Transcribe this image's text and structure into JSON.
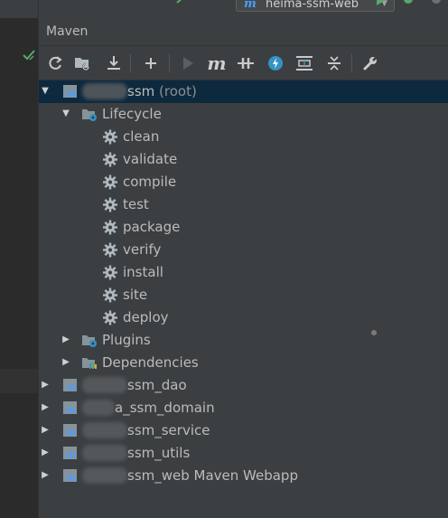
{
  "run_toolbar": {
    "configuration": "heima-ssm-web"
  },
  "panel": {
    "title": "Maven"
  },
  "toolbar_icons": [
    "reimport-icon",
    "generate-sources-icon",
    "download-icon",
    "add-project-icon",
    "run-icon",
    "execute-goal-icon",
    "toggle-offline-icon",
    "skip-tests-icon",
    "show-dependencies-icon",
    "expand-all-icon",
    "collapse-all-icon",
    "settings-wrench-icon"
  ],
  "tree": {
    "root": {
      "name": "ssm",
      "suffix": "(root)"
    },
    "lifecycle": "Lifecycle",
    "goals": [
      "clean",
      "validate",
      "compile",
      "test",
      "package",
      "verify",
      "install",
      "site",
      "deploy"
    ],
    "plugins": "Plugins",
    "dependencies": "Dependencies",
    "modules": [
      "ssm_dao",
      "a_ssm_domain",
      "ssm_service",
      "ssm_utils",
      "ssm_web Maven Webapp"
    ]
  },
  "colors": {
    "selection": "#0d293e",
    "accent_blue": "#4a9eff",
    "run_green": "#59a869",
    "panel_bg": "#3c3f41"
  }
}
